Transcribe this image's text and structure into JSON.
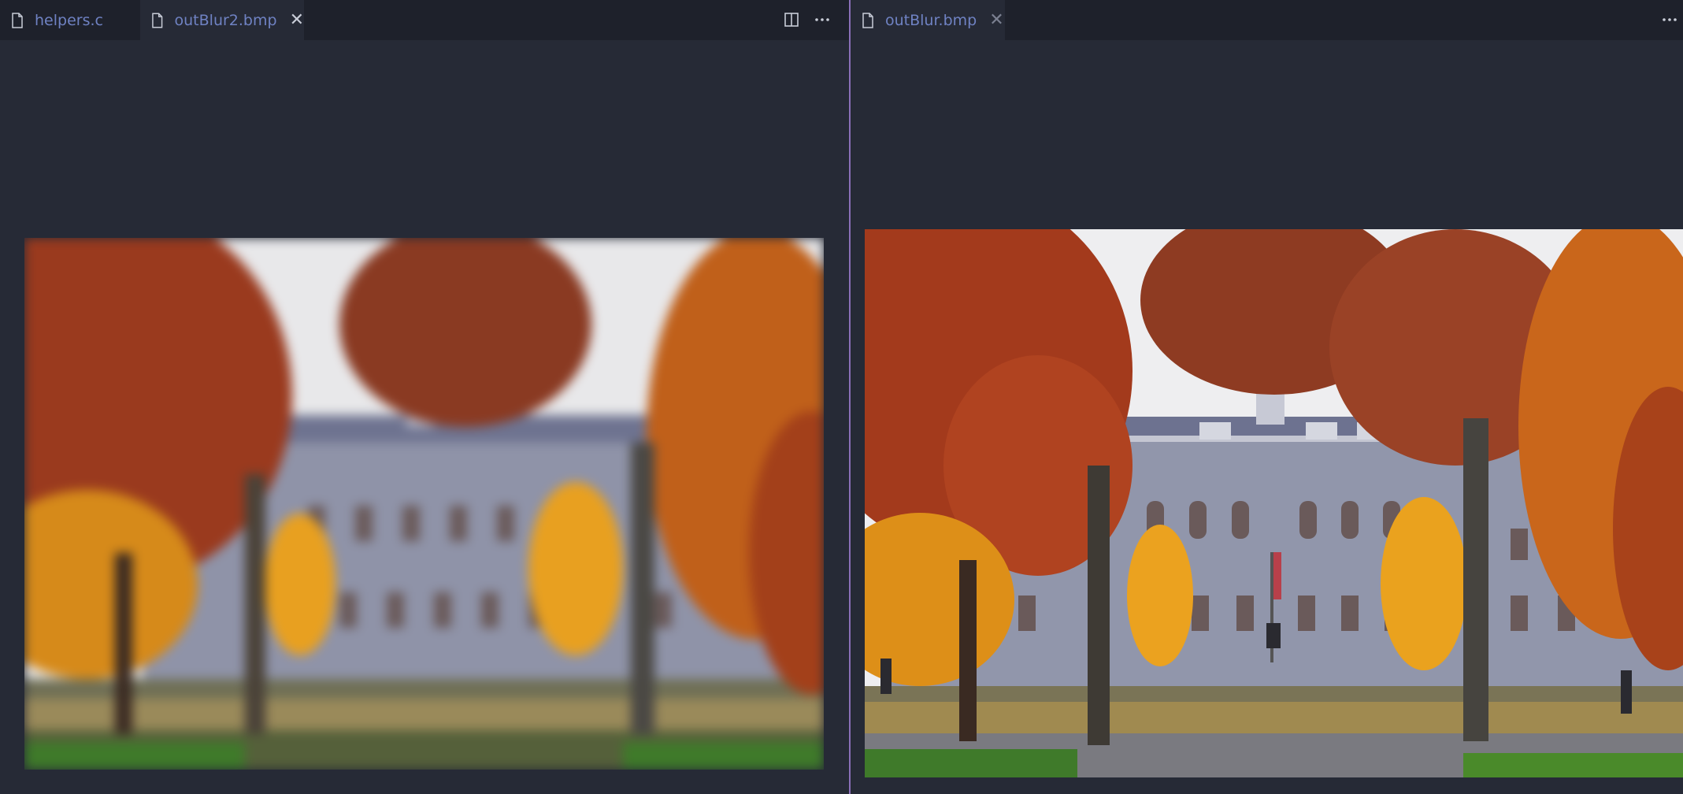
{
  "left_pane": {
    "tabs": [
      {
        "label": "helpers.c",
        "active": false
      },
      {
        "label": "outBlur2.bmp",
        "active": true
      }
    ],
    "split_icon": "split-editor-icon",
    "more_icon": "more-actions-icon",
    "image": {
      "description_icon": "bmp-image-preview",
      "blurred": true
    }
  },
  "right_pane": {
    "tabs": [
      {
        "label": "outBlur.bmp",
        "active": true
      }
    ],
    "more_icon": "more-actions-icon",
    "image": {
      "description_icon": "bmp-image-preview",
      "blurred": false
    }
  },
  "colors": {
    "background": "#262a36",
    "tabbar": "#1e212b",
    "tab_text": "#6f82c3",
    "divider": "#8a6fb8"
  }
}
